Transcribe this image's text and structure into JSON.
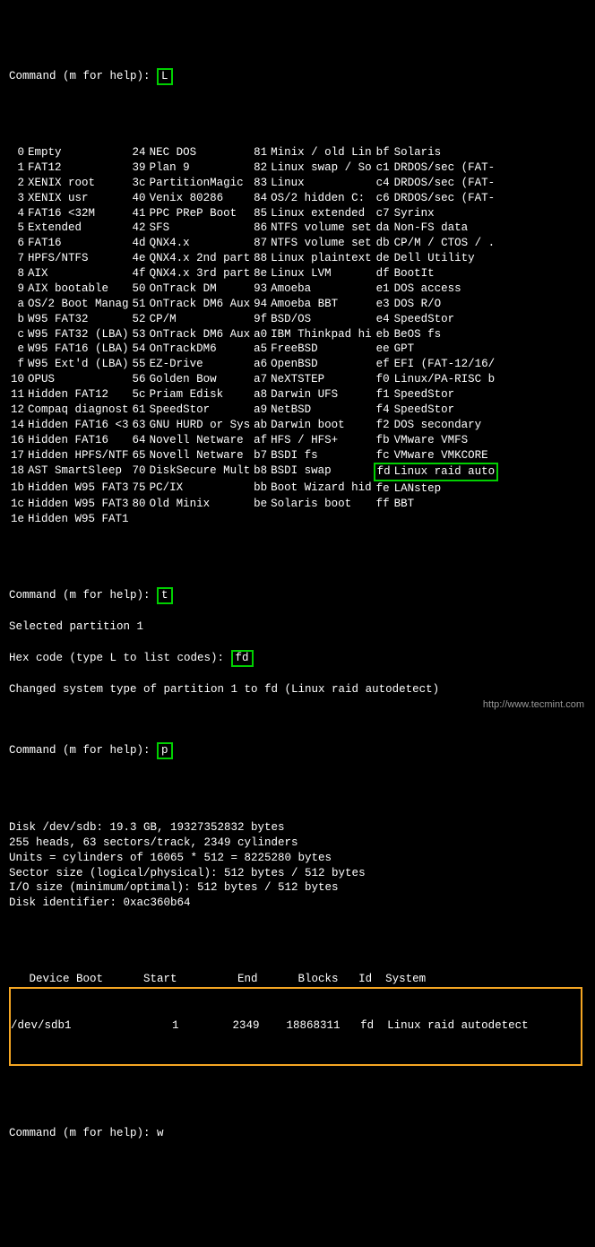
{
  "prompts": {
    "cmd": "Command (m for help): ",
    "hex": "Hex code (type L to list codes): ",
    "selected": "Selected partition 1",
    "changed": "Changed system type of partition 1 to fd (Linux raid autodetect)"
  },
  "inputs": {
    "L": "L",
    "t": "t",
    "fd": "fd",
    "p": "p",
    "w": "w"
  },
  "types": [
    [
      " 0",
      "Empty",
      "24",
      "NEC DOS",
      "81",
      "Minix / old Lin",
      "bf",
      "Solaris"
    ],
    [
      " 1",
      "FAT12",
      "39",
      "Plan 9",
      "82",
      "Linux swap / So",
      "c1",
      "DRDOS/sec (FAT-"
    ],
    [
      " 2",
      "XENIX root",
      "3c",
      "PartitionMagic",
      "83",
      "Linux",
      "c4",
      "DRDOS/sec (FAT-"
    ],
    [
      " 3",
      "XENIX usr",
      "40",
      "Venix 80286",
      "84",
      "OS/2 hidden C:",
      "c6",
      "DRDOS/sec (FAT-"
    ],
    [
      " 4",
      "FAT16 <32M",
      "41",
      "PPC PReP Boot",
      "85",
      "Linux extended",
      "c7",
      "Syrinx"
    ],
    [
      " 5",
      "Extended",
      "42",
      "SFS",
      "86",
      "NTFS volume set",
      "da",
      "Non-FS data"
    ],
    [
      " 6",
      "FAT16",
      "4d",
      "QNX4.x",
      "87",
      "NTFS volume set",
      "db",
      "CP/M / CTOS / ."
    ],
    [
      " 7",
      "HPFS/NTFS",
      "4e",
      "QNX4.x 2nd part",
      "88",
      "Linux plaintext",
      "de",
      "Dell Utility"
    ],
    [
      " 8",
      "AIX",
      "4f",
      "QNX4.x 3rd part",
      "8e",
      "Linux LVM",
      "df",
      "BootIt"
    ],
    [
      " 9",
      "AIX bootable",
      "50",
      "OnTrack DM",
      "93",
      "Amoeba",
      "e1",
      "DOS access"
    ],
    [
      " a",
      "OS/2 Boot Manag",
      "51",
      "OnTrack DM6 Aux",
      "94",
      "Amoeba BBT",
      "e3",
      "DOS R/O"
    ],
    [
      " b",
      "W95 FAT32",
      "52",
      "CP/M",
      "9f",
      "BSD/OS",
      "e4",
      "SpeedStor"
    ],
    [
      " c",
      "W95 FAT32 (LBA)",
      "53",
      "OnTrack DM6 Aux",
      "a0",
      "IBM Thinkpad hi",
      "eb",
      "BeOS fs"
    ],
    [
      " e",
      "W95 FAT16 (LBA)",
      "54",
      "OnTrackDM6",
      "a5",
      "FreeBSD",
      "ee",
      "GPT"
    ],
    [
      " f",
      "W95 Ext'd (LBA)",
      "55",
      "EZ-Drive",
      "a6",
      "OpenBSD",
      "ef",
      "EFI (FAT-12/16/"
    ],
    [
      "10",
      "OPUS",
      "56",
      "Golden Bow",
      "a7",
      "NeXTSTEP",
      "f0",
      "Linux/PA-RISC b"
    ],
    [
      "11",
      "Hidden FAT12",
      "5c",
      "Priam Edisk",
      "a8",
      "Darwin UFS",
      "f1",
      "SpeedStor"
    ],
    [
      "12",
      "Compaq diagnost",
      "61",
      "SpeedStor",
      "a9",
      "NetBSD",
      "f4",
      "SpeedStor"
    ],
    [
      "14",
      "Hidden FAT16 <3",
      "63",
      "GNU HURD or Sys",
      "ab",
      "Darwin boot",
      "f2",
      "DOS secondary"
    ],
    [
      "16",
      "Hidden FAT16",
      "64",
      "Novell Netware",
      "af",
      "HFS / HFS+",
      "fb",
      "VMware VMFS"
    ],
    [
      "17",
      "Hidden HPFS/NTF",
      "65",
      "Novell Netware",
      "b7",
      "BSDI fs",
      "fc",
      "VMware VMKCORE"
    ],
    [
      "18",
      "AST SmartSleep",
      "70",
      "DiskSecure Mult",
      "b8",
      "BSDI swap",
      "fd",
      "Linux raid auto"
    ],
    [
      "1b",
      "Hidden W95 FAT3",
      "75",
      "PC/IX",
      "bb",
      "Boot Wizard hid",
      "fe",
      "LANstep"
    ],
    [
      "1c",
      "Hidden W95 FAT3",
      "80",
      "Old Minix",
      "be",
      "Solaris boot",
      "ff",
      "BBT"
    ],
    [
      "1e",
      "Hidden W95 FAT1",
      "",
      "",
      "",
      "",
      "",
      ""
    ]
  ],
  "disk_info": [
    "Disk /dev/sdb: 19.3 GB, 19327352832 bytes",
    "255 heads, 63 sectors/track, 2349 cylinders",
    "Units = cylinders of 16065 * 512 = 8225280 bytes",
    "Sector size (logical/physical): 512 bytes / 512 bytes",
    "I/O size (minimum/optimal): 512 bytes / 512 bytes",
    "Disk identifier: 0xac360b64"
  ],
  "pt_header": "   Device Boot      Start         End      Blocks   Id  System",
  "pt_row": "/dev/sdb1               1        2349    18868311   fd  Linux raid autodetect  ",
  "footer": "http://www.tecmint.com"
}
